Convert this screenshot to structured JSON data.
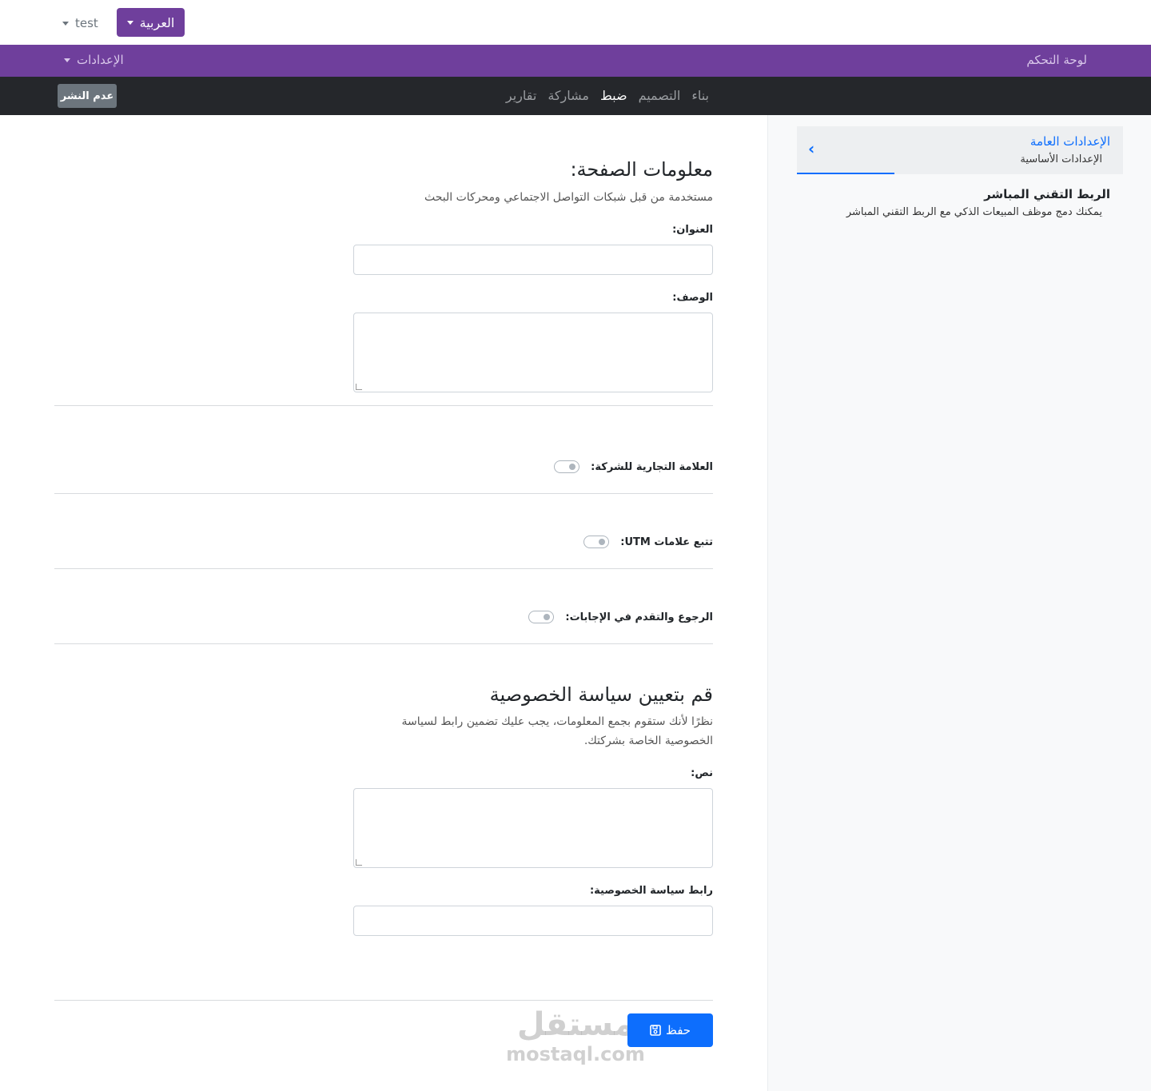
{
  "topbar": {
    "language": "العربية",
    "user": "test"
  },
  "navbar": {
    "dashboard": "لوحة التحكم",
    "settings": "الإعدادات"
  },
  "tabs": [
    {
      "label": "بناء",
      "active": false
    },
    {
      "label": "التصميم",
      "active": false
    },
    {
      "label": "ضبط",
      "active": true
    },
    {
      "label": "مشاركة",
      "active": false
    },
    {
      "label": "تقارير",
      "active": false
    }
  ],
  "actions": {
    "unpublish": "عدم النشر",
    "save": "حفظ"
  },
  "sidebar": {
    "general_title": "الإعدادات العامة",
    "general_sub": "الإعدادات الأساسية",
    "live_title": "الربط التقني المباشر",
    "live_desc": "يمكنك دمج موظف المبيعات الذكي مع الربط التقني المباشر"
  },
  "page_info": {
    "heading": "معلومات الصفحة:",
    "subtitle": "مستخدمة من قبل شبكات التواصل الاجتماعي ومحركات البحث",
    "title_label": "العنوان:",
    "title_value": "",
    "description_label": "الوصف:",
    "description_value": ""
  },
  "toggles": {
    "branding": "العلامة التجارية للشركة:",
    "utm": "تتبع علامات UTM:",
    "navigation": "الرجوع والتقدم في الإجابات:"
  },
  "privacy": {
    "heading": "قم بتعيين سياسة الخصوصية",
    "desc_line1": "نظرًا لأنك ستقوم بجمع المعلومات، يجب عليك تضمين رابط لسياسة",
    "desc_line2": "الخصوصية الخاصة بشركتك.",
    "text_label": "نص:",
    "text_value": "",
    "link_label": "رابط سياسة الخصوصية:",
    "link_value": ""
  },
  "watermark": {
    "arabic": "مستقل",
    "latin": "mostaql.com"
  },
  "colors": {
    "brand_purple": "#6f3f9c",
    "dark_nav": "#25272b",
    "primary": "#0d6efd",
    "secondary": "#6c757d"
  }
}
